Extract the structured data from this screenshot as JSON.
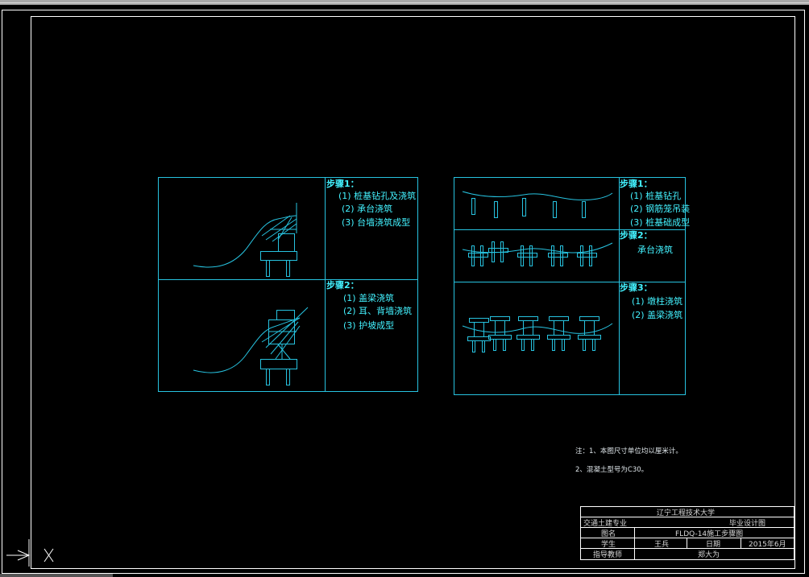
{
  "colors": {
    "background": "#000000",
    "frame": "#ffffff",
    "drawing": "#27c3e0",
    "text_cyan": "#43f2ff",
    "text_white": "#dfe6ea"
  },
  "left_panel": {
    "step1": {
      "heading": "步骤1：",
      "items": [
        "(1) 桩基钻孔及浇筑",
        "(2) 承台浇筑",
        "(3) 台墙浇筑成型"
      ]
    },
    "step2": {
      "heading": "步骤2：",
      "items": [
        "(1) 盖梁浇筑",
        "(2) 耳、背墙浇筑",
        "(3) 护坡成型"
      ]
    }
  },
  "right_panel": {
    "step1": {
      "heading": "步骤1：",
      "items": [
        "(1) 桩基钻孔",
        "(2) 钢筋笼吊装",
        "(3) 桩基础成型"
      ]
    },
    "step2": {
      "heading": "步骤2：",
      "items": [
        "承台浇筑"
      ]
    },
    "step3": {
      "heading": "步骤3：",
      "items": [
        "(1) 墩柱浇筑",
        "(2) 盖梁浇筑"
      ]
    }
  },
  "notes": [
    "注：1、本图尺寸单位均以厘米计。",
    "2、混凝土型号为C30。"
  ],
  "title_block": {
    "university": "辽宁工程技术大学",
    "major": "交通土建专业",
    "design_type": "毕业设计图",
    "drawing_name_label": "图名",
    "drawing_name": "FLDQ-14施工步骤图",
    "student_label": "学生",
    "student_name": "王兵",
    "date_label": "日期",
    "date": "2015年6月",
    "advisor_label": "指导教师",
    "advisor_name": "郑大为"
  }
}
